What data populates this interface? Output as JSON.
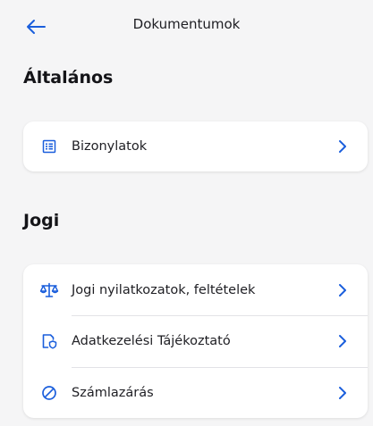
{
  "header": {
    "title": "Dokumentumok",
    "back_icon": "arrow-left-icon"
  },
  "sections": [
    {
      "title": "Általános",
      "items": [
        {
          "label": "Bizonylatok",
          "icon": "receipt-list-icon"
        }
      ]
    },
    {
      "title": "Jogi",
      "items": [
        {
          "label": "Jogi nyilatkozatok, feltételek",
          "icon": "scales-icon"
        },
        {
          "label": "Adatkezelési Tájékoztató",
          "icon": "document-shield-icon"
        },
        {
          "label": "Számlazárás",
          "icon": "prohibited-circle-icon"
        }
      ]
    }
  ],
  "colors": {
    "accent": "#1a5edc",
    "background": "#f5f5f6",
    "card": "#ffffff",
    "text": "#1e1e23"
  }
}
